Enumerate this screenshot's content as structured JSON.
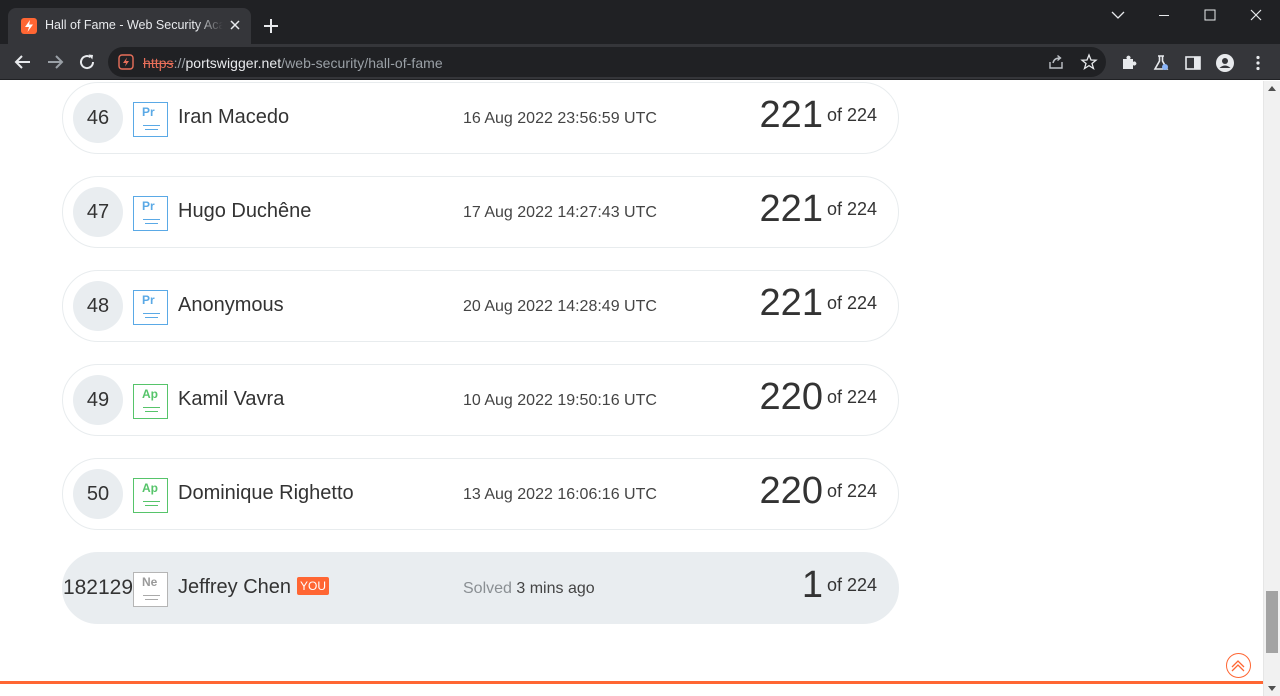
{
  "browser": {
    "tab_title": "Hall of Fame - Web Security Academy",
    "url_scheme": "https",
    "url_sep": "://",
    "url_host": "portswigger.net",
    "url_path": "/web-security/hall-of-fame"
  },
  "rows": [
    {
      "rank": "46",
      "level": "Pr",
      "name": "Iran Macedo",
      "time": "16 Aug 2022 23:56:59 UTC",
      "score": "221",
      "of": "of 224"
    },
    {
      "rank": "47",
      "level": "Pr",
      "name": "Hugo Duchêne",
      "time": "17 Aug 2022 14:27:43 UTC",
      "score": "221",
      "of": "of 224"
    },
    {
      "rank": "48",
      "level": "Pr",
      "name": "Anonymous",
      "time": "20 Aug 2022 14:28:49 UTC",
      "score": "221",
      "of": "of 224"
    },
    {
      "rank": "49",
      "level": "Ap",
      "name": "Kamil Vavra",
      "time": "10 Aug 2022 19:50:16 UTC",
      "score": "220",
      "of": "of 224"
    },
    {
      "rank": "50",
      "level": "Ap",
      "name": "Dominique Righetto",
      "time": "13 Aug 2022 16:06:16 UTC",
      "score": "220",
      "of": "of 224"
    }
  ],
  "current_user": {
    "rank": "182129",
    "level": "Ne",
    "name": "Jeffrey Chen",
    "you_label": "YOU",
    "solved_label": "Solved",
    "solved_ago": "3 mins ago",
    "score": "1",
    "of": "of 224"
  },
  "colors": {
    "accent": "#ff6633",
    "practitioner": "#5aa9e6",
    "apprentice": "#56c46a",
    "newcomer": "#9a9a9a"
  }
}
